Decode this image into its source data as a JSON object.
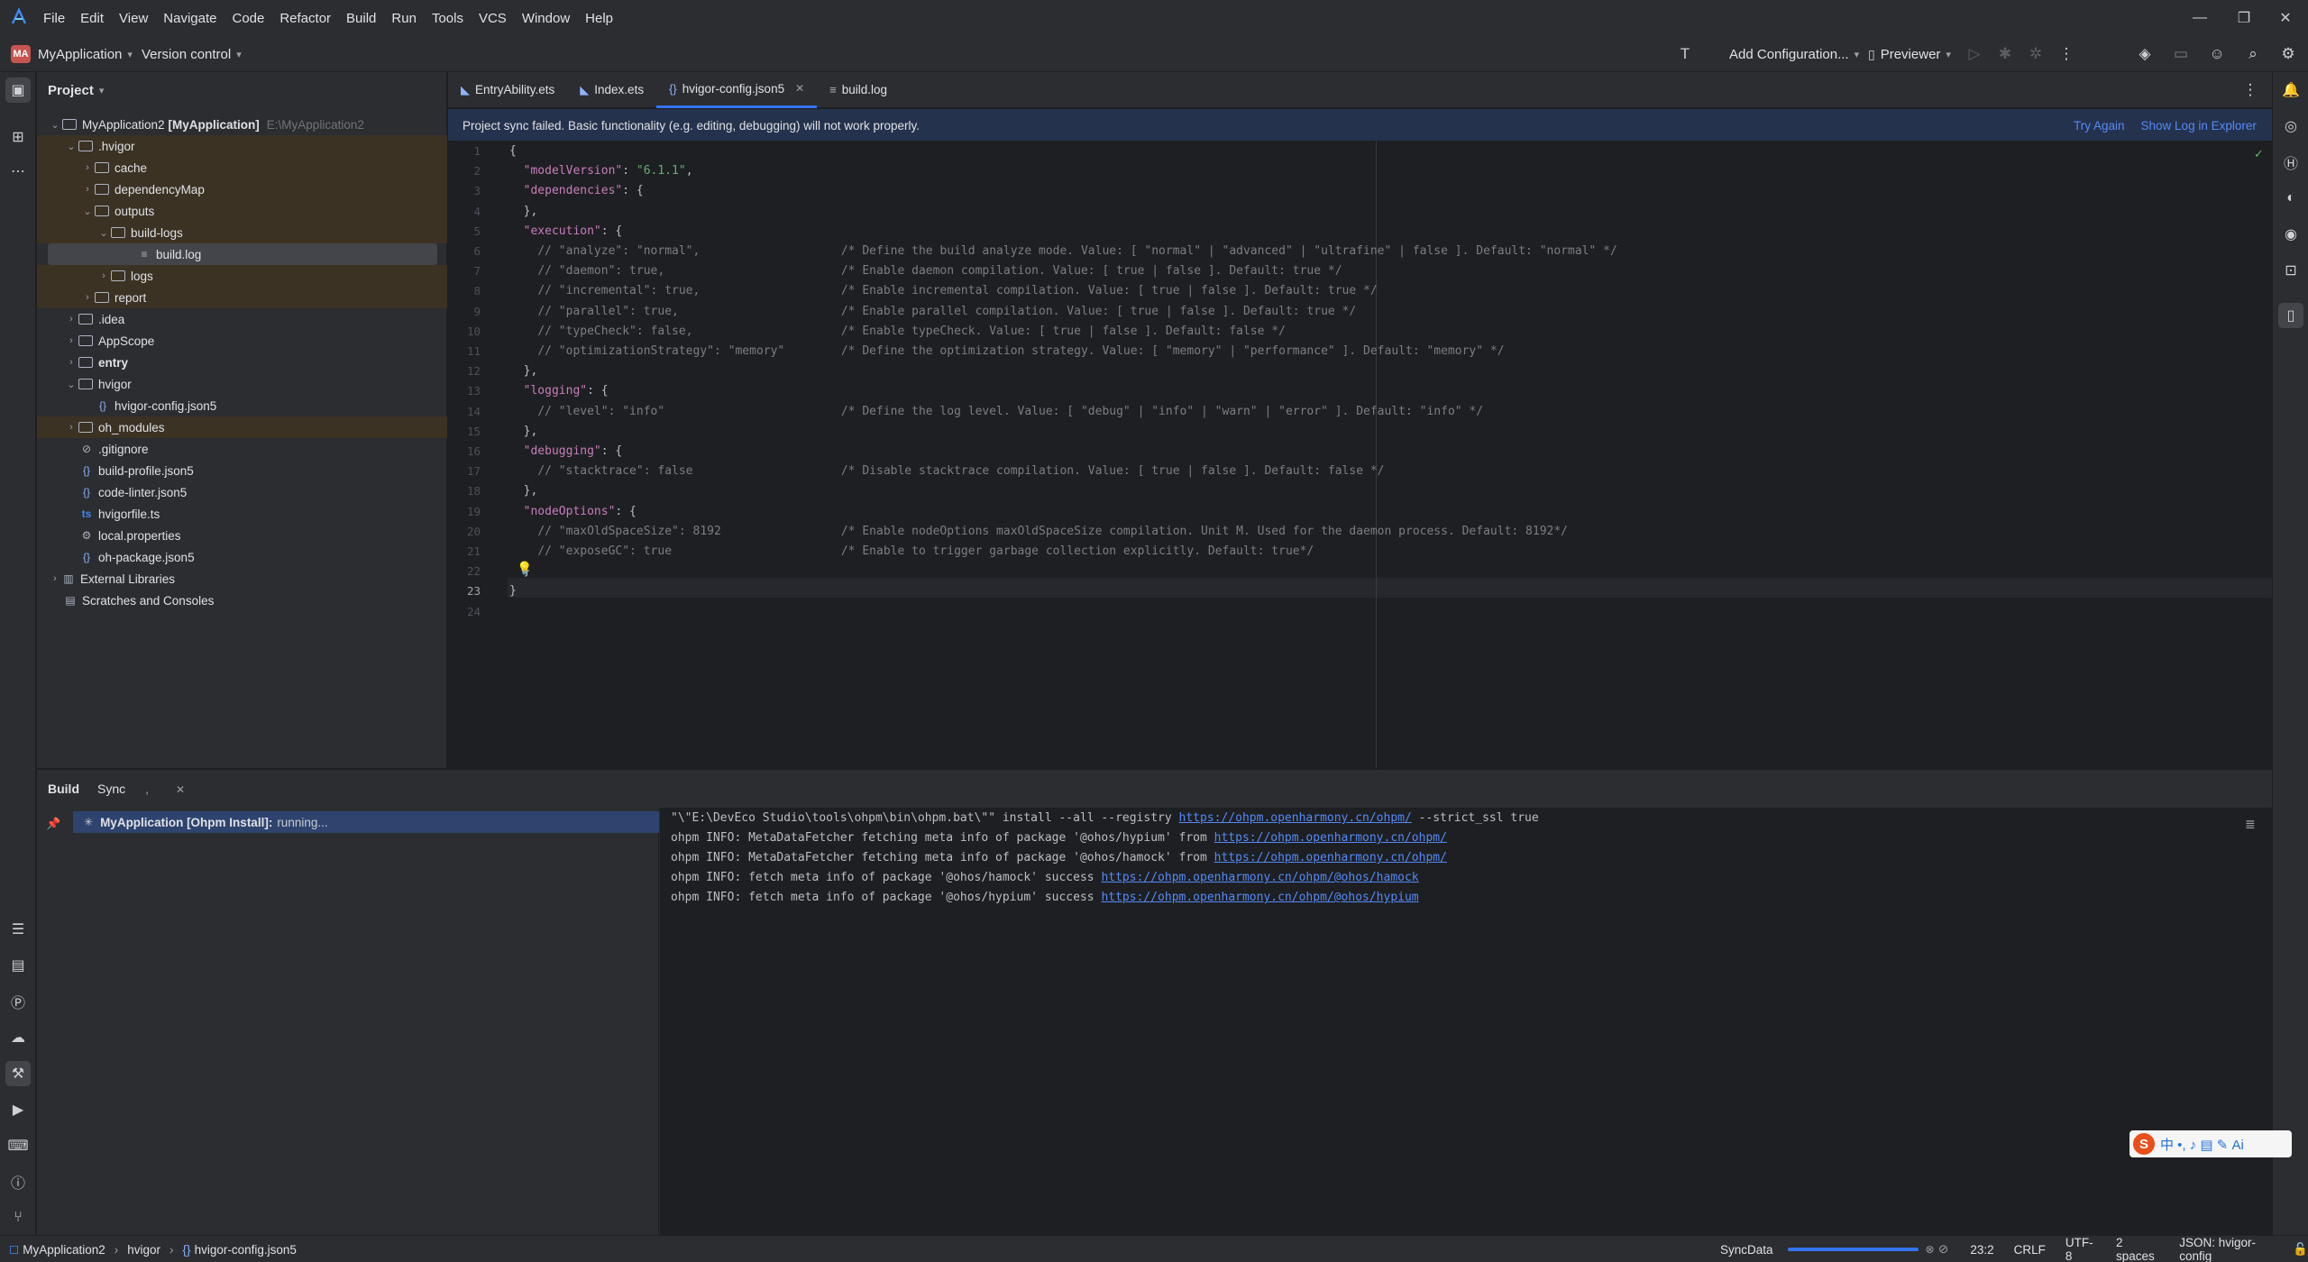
{
  "menubar": {
    "items": [
      "File",
      "Edit",
      "View",
      "Navigate",
      "Code",
      "Refactor",
      "Build",
      "Run",
      "Tools",
      "VCS",
      "Window",
      "Help"
    ]
  },
  "toolbar": {
    "project_badge": "MA",
    "project_name": "MyApplication",
    "version_control": "Version control",
    "add_configuration": "Add Configuration...",
    "previewer": "Previewer"
  },
  "project_panel": {
    "title": "Project",
    "tree": [
      {
        "label": "MyApplication2",
        "bold_suffix": "[MyApplication]",
        "path": "E:\\MyApplication2"
      },
      {
        "label": ".hvigor"
      },
      {
        "label": "cache"
      },
      {
        "label": "dependencyMap"
      },
      {
        "label": "outputs"
      },
      {
        "label": "build-logs"
      },
      {
        "label": "build.log"
      },
      {
        "label": "logs"
      },
      {
        "label": "report"
      },
      {
        "label": ".idea"
      },
      {
        "label": "AppScope"
      },
      {
        "label": "entry"
      },
      {
        "label": "hvigor"
      },
      {
        "label": "hvigor-config.json5"
      },
      {
        "label": "oh_modules"
      },
      {
        "label": ".gitignore"
      },
      {
        "label": "build-profile.json5"
      },
      {
        "label": "code-linter.json5"
      },
      {
        "label": "hvigorfile.ts"
      },
      {
        "label": "local.properties"
      },
      {
        "label": "oh-package.json5"
      },
      {
        "label": "External Libraries"
      },
      {
        "label": "Scratches and Consoles"
      }
    ]
  },
  "editor_tabs": [
    {
      "label": "EntryAbility.ets"
    },
    {
      "label": "Index.ets"
    },
    {
      "label": "hvigor-config.json5"
    },
    {
      "label": "build.log"
    }
  ],
  "banner": {
    "message": "Project sync failed. Basic functionality (e.g. editing, debugging) will not work properly.",
    "try_again": "Try Again",
    "show_log": "Show Log in Explorer"
  },
  "code": {
    "line_numbers": [
      "1",
      "2",
      "3",
      "4",
      "5",
      "6",
      "7",
      "8",
      "9",
      "10",
      "11",
      "12",
      "13",
      "14",
      "15",
      "16",
      "17",
      "18",
      "19",
      "20",
      "21",
      "22",
      "23",
      "24"
    ],
    "lines": [
      "{",
      "  \"modelVersion\": \"6.1.1\",",
      "  \"dependencies\": {",
      "  },",
      "  \"execution\": {",
      "    // \"analyze\": \"normal\",                    /* Define the build analyze mode. Value: [ \"normal\" | \"advanced\" | \"ultrafine\" | false ]. Default: \"normal\" */",
      "    // \"daemon\": true,                         /* Enable daemon compilation. Value: [ true | false ]. Default: true */",
      "    // \"incremental\": true,                    /* Enable incremental compilation. Value: [ true | false ]. Default: true */",
      "    // \"parallel\": true,                       /* Enable parallel compilation. Value: [ true | false ]. Default: true */",
      "    // \"typeCheck\": false,                     /* Enable typeCheck. Value: [ true | false ]. Default: false */",
      "    // \"optimizationStrategy\": \"memory\"        /* Define the optimization strategy. Value: [ \"memory\" | \"performance\" ]. Default: \"memory\" */",
      "  },",
      "  \"logging\": {",
      "    // \"level\": \"info\"                         /* Define the log level. Value: [ \"debug\" | \"info\" | \"warn\" | \"error\" ]. Default: \"info\" */",
      "  },",
      "  \"debugging\": {",
      "    // \"stacktrace\": false                     /* Disable stacktrace compilation. Value: [ true | false ]. Default: false */",
      "  },",
      "  \"nodeOptions\": {",
      "    // \"maxOldSpaceSize\": 8192                 /* Enable nodeOptions maxOldSpaceSize compilation. Unit M. Used for the daemon process. Default: 8192*/",
      "    // \"exposeGC\": true                        /* Enable to trigger garbage collection explicitly. Default: true*/",
      "  }",
      "}",
      ""
    ]
  },
  "bottom_panel": {
    "tabs": [
      "Build",
      "Sync"
    ],
    "build_item": "MyApplication [Ohpm Install]:",
    "build_status": "running...",
    "console": [
      {
        "text": "\"\\\"E:\\DevEco Studio\\tools\\ohpm\\bin\\ohpm.bat\\\"\" install --all --registry ",
        "url": "https://ohpm.openharmony.cn/ohpm/",
        "after": " --strict_ssl true"
      },
      {
        "text": "ohpm INFO: MetaDataFetcher fetching meta info of package '@ohos/hypium' from ",
        "url": "https://ohpm.openharmony.cn/ohpm/",
        "after": ""
      },
      {
        "text": "ohpm INFO: MetaDataFetcher fetching meta info of package '@ohos/hamock' from ",
        "url": "https://ohpm.openharmony.cn/ohpm/",
        "after": ""
      },
      {
        "text": "ohpm INFO: fetch meta info of package '@ohos/hamock' success ",
        "url": "https://ohpm.openharmony.cn/ohpm/@ohos/hamock",
        "after": ""
      },
      {
        "text": "ohpm INFO: fetch meta info of package '@ohos/hypium' success ",
        "url": "https://ohpm.openharmony.cn/ohpm/@ohos/hypium",
        "after": ""
      }
    ]
  },
  "ime": {
    "glyphs": "中 •, ♪ ▤ ✎ Ai"
  },
  "statusbar": {
    "breadcrumb": [
      "MyApplication2",
      "hvigor",
      "hvigor-config.json5"
    ],
    "task": "SyncData",
    "progress": 1.0,
    "position": "23:2",
    "line_sep": "CRLF",
    "encoding": "UTF-8",
    "indent": "2 spaces",
    "file_type": "JSON: hvigor-config"
  },
  "colors": {
    "accent": "#3574f0",
    "banner": "#25324d",
    "string": "#6aab73",
    "key": "#c77dbb",
    "comment": "#7a7e85"
  }
}
